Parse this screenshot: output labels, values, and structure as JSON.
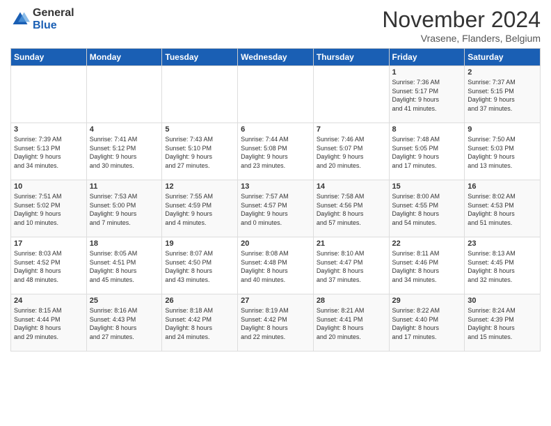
{
  "logo": {
    "general": "General",
    "blue": "Blue"
  },
  "title": "November 2024",
  "location": "Vrasene, Flanders, Belgium",
  "days_of_week": [
    "Sunday",
    "Monday",
    "Tuesday",
    "Wednesday",
    "Thursday",
    "Friday",
    "Saturday"
  ],
  "weeks": [
    [
      {
        "day": "",
        "info": ""
      },
      {
        "day": "",
        "info": ""
      },
      {
        "day": "",
        "info": ""
      },
      {
        "day": "",
        "info": ""
      },
      {
        "day": "",
        "info": ""
      },
      {
        "day": "1",
        "info": "Sunrise: 7:36 AM\nSunset: 5:17 PM\nDaylight: 9 hours\nand 41 minutes."
      },
      {
        "day": "2",
        "info": "Sunrise: 7:37 AM\nSunset: 5:15 PM\nDaylight: 9 hours\nand 37 minutes."
      }
    ],
    [
      {
        "day": "3",
        "info": "Sunrise: 7:39 AM\nSunset: 5:13 PM\nDaylight: 9 hours\nand 34 minutes."
      },
      {
        "day": "4",
        "info": "Sunrise: 7:41 AM\nSunset: 5:12 PM\nDaylight: 9 hours\nand 30 minutes."
      },
      {
        "day": "5",
        "info": "Sunrise: 7:43 AM\nSunset: 5:10 PM\nDaylight: 9 hours\nand 27 minutes."
      },
      {
        "day": "6",
        "info": "Sunrise: 7:44 AM\nSunset: 5:08 PM\nDaylight: 9 hours\nand 23 minutes."
      },
      {
        "day": "7",
        "info": "Sunrise: 7:46 AM\nSunset: 5:07 PM\nDaylight: 9 hours\nand 20 minutes."
      },
      {
        "day": "8",
        "info": "Sunrise: 7:48 AM\nSunset: 5:05 PM\nDaylight: 9 hours\nand 17 minutes."
      },
      {
        "day": "9",
        "info": "Sunrise: 7:50 AM\nSunset: 5:03 PM\nDaylight: 9 hours\nand 13 minutes."
      }
    ],
    [
      {
        "day": "10",
        "info": "Sunrise: 7:51 AM\nSunset: 5:02 PM\nDaylight: 9 hours\nand 10 minutes."
      },
      {
        "day": "11",
        "info": "Sunrise: 7:53 AM\nSunset: 5:00 PM\nDaylight: 9 hours\nand 7 minutes."
      },
      {
        "day": "12",
        "info": "Sunrise: 7:55 AM\nSunset: 4:59 PM\nDaylight: 9 hours\nand 4 minutes."
      },
      {
        "day": "13",
        "info": "Sunrise: 7:57 AM\nSunset: 4:57 PM\nDaylight: 9 hours\nand 0 minutes."
      },
      {
        "day": "14",
        "info": "Sunrise: 7:58 AM\nSunset: 4:56 PM\nDaylight: 8 hours\nand 57 minutes."
      },
      {
        "day": "15",
        "info": "Sunrise: 8:00 AM\nSunset: 4:55 PM\nDaylight: 8 hours\nand 54 minutes."
      },
      {
        "day": "16",
        "info": "Sunrise: 8:02 AM\nSunset: 4:53 PM\nDaylight: 8 hours\nand 51 minutes."
      }
    ],
    [
      {
        "day": "17",
        "info": "Sunrise: 8:03 AM\nSunset: 4:52 PM\nDaylight: 8 hours\nand 48 minutes."
      },
      {
        "day": "18",
        "info": "Sunrise: 8:05 AM\nSunset: 4:51 PM\nDaylight: 8 hours\nand 45 minutes."
      },
      {
        "day": "19",
        "info": "Sunrise: 8:07 AM\nSunset: 4:50 PM\nDaylight: 8 hours\nand 43 minutes."
      },
      {
        "day": "20",
        "info": "Sunrise: 8:08 AM\nSunset: 4:48 PM\nDaylight: 8 hours\nand 40 minutes."
      },
      {
        "day": "21",
        "info": "Sunrise: 8:10 AM\nSunset: 4:47 PM\nDaylight: 8 hours\nand 37 minutes."
      },
      {
        "day": "22",
        "info": "Sunrise: 8:11 AM\nSunset: 4:46 PM\nDaylight: 8 hours\nand 34 minutes."
      },
      {
        "day": "23",
        "info": "Sunrise: 8:13 AM\nSunset: 4:45 PM\nDaylight: 8 hours\nand 32 minutes."
      }
    ],
    [
      {
        "day": "24",
        "info": "Sunrise: 8:15 AM\nSunset: 4:44 PM\nDaylight: 8 hours\nand 29 minutes."
      },
      {
        "day": "25",
        "info": "Sunrise: 8:16 AM\nSunset: 4:43 PM\nDaylight: 8 hours\nand 27 minutes."
      },
      {
        "day": "26",
        "info": "Sunrise: 8:18 AM\nSunset: 4:42 PM\nDaylight: 8 hours\nand 24 minutes."
      },
      {
        "day": "27",
        "info": "Sunrise: 8:19 AM\nSunset: 4:42 PM\nDaylight: 8 hours\nand 22 minutes."
      },
      {
        "day": "28",
        "info": "Sunrise: 8:21 AM\nSunset: 4:41 PM\nDaylight: 8 hours\nand 20 minutes."
      },
      {
        "day": "29",
        "info": "Sunrise: 8:22 AM\nSunset: 4:40 PM\nDaylight: 8 hours\nand 17 minutes."
      },
      {
        "day": "30",
        "info": "Sunrise: 8:24 AM\nSunset: 4:39 PM\nDaylight: 8 hours\nand 15 minutes."
      }
    ]
  ]
}
